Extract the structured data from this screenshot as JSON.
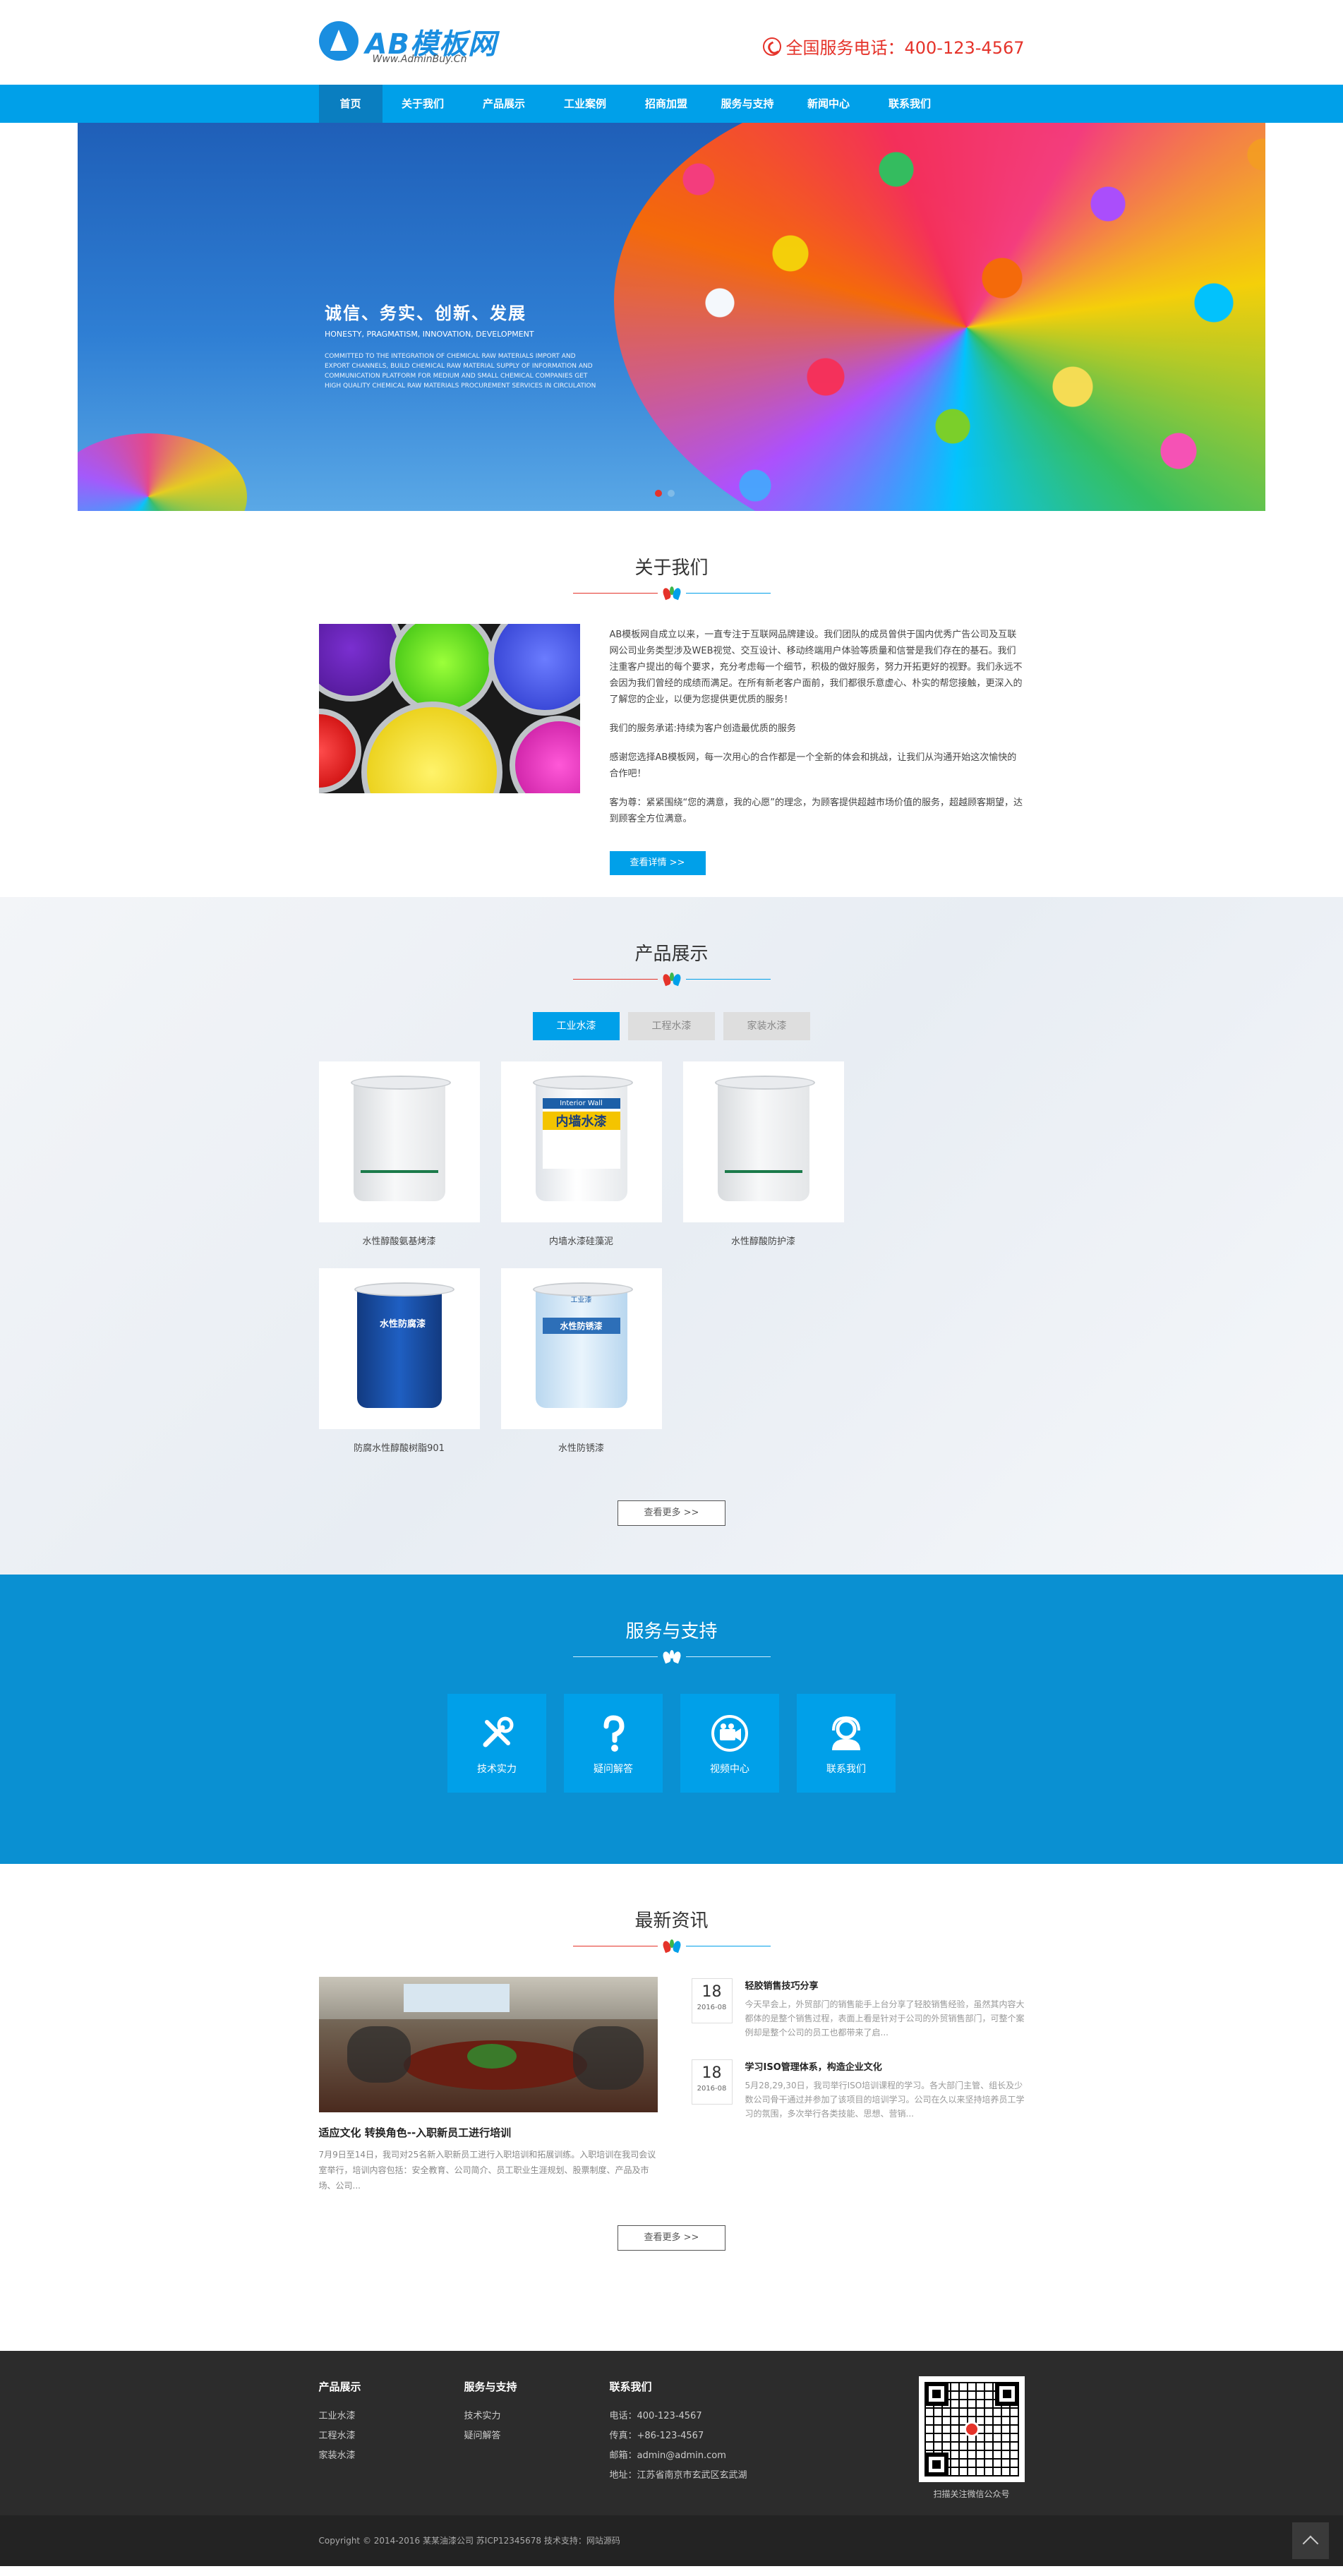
{
  "header": {
    "logo_title": "AB模板网",
    "logo_sub": "Www.AdminBuy.Cn",
    "hotline": "全国服务电话：400-123-4567"
  },
  "nav": [
    "首页",
    "关于我们",
    "产品展示",
    "工业案例",
    "招商加盟",
    "服务与支持",
    "新闻中心",
    "联系我们"
  ],
  "banner": {
    "heading": "诚信、务实、创新、发展",
    "english": "HONESTY, PRAGMATISM, INNOVATION, DEVELOPMENT",
    "paragraph": "COMMITTED TO THE INTEGRATION OF CHEMICAL RAW MATERIALS IMPORT AND EXPORT CHANNELS, BUILD CHEMICAL RAW MATERIAL SUPPLY OF INFORMATION AND COMMUNICATION PLATFORM FOR MEDIUM AND SMALL CHEMICAL COMPANIES GET HIGH QUALITY CHEMICAL RAW MATERIALS PROCUREMENT SERVICES IN CIRCULATION"
  },
  "about": {
    "title": "关于我们",
    "paragraphs": [
      "AB模板网自成立以来，一直专注于互联网品牌建设。我们团队的成员曾供于国内优秀广告公司及互联网公司业务类型涉及WEB视觉、交互设计、移动终端用户体验等质量和信誉是我们存在的基石。我们注重客户提出的每个要求，充分考虑每一个细节，积极的做好服务，努力开拓更好的视野。我们永远不会因为我们曾经的成绩而满足。在所有新老客户面前，我们都很乐意虚心、朴实的帮您接触，更深入的了解您的企业，以便为您提供更优质的服务！",
      "我们的服务承诺:持续为客户创造最优质的服务",
      "感谢您选择AB模板网，每一次用心的合作都是一个全新的体会和挑战，让我们从沟通开始这次愉快的合作吧！",
      "客为尊：紧紧围绕“您的满意，我的心愿”的理念，为顾客提供超越市场价值的服务，超越顾客期望，达到顾客全方位满意。"
    ],
    "button": "查看详情 >>"
  },
  "products": {
    "title": "产品展示",
    "tabs": [
      "工业水漆",
      "工程水漆",
      "家装水漆"
    ],
    "items": [
      "水性醇酸氨基烤漆",
      "内墙水漆硅藻泥",
      "水性醇酸防护漆",
      "防腐水性醇酸树脂901",
      "水性防锈漆"
    ],
    "bucket_texts": [
      "Interior Wall",
      "内墙水漆",
      "水性防腐漆",
      "工业漆",
      "水性防锈漆"
    ],
    "more": "查看更多 >>"
  },
  "service": {
    "title": "服务与支持",
    "items": [
      {
        "label": "技术实力",
        "icon": "tools-icon"
      },
      {
        "label": "疑问解答",
        "icon": "question-icon"
      },
      {
        "label": "视频中心",
        "icon": "video-icon"
      },
      {
        "label": "联系我们",
        "icon": "support-icon"
      }
    ]
  },
  "news": {
    "title": "最新资讯",
    "featured": {
      "title": "适应文化 转换角色--入职新员工进行培训",
      "desc": "7月9日至14日，我司对25名新入职新员工进行入职培训和拓展训练。入职培训在我司会议室举行，培训内容包括：安全教育、公司简介、员工职业生涯规划、股票制度、产品及市场、公司..."
    },
    "items": [
      {
        "day": "18",
        "month": "2016-08",
        "title": "轻胶销售技巧分享",
        "desc": "今天早会上，外贸部门的销售能手上台分享了轻胶销售经验，虽然其内容大都体的是整个销售过程，表面上看是针对于公司的外贸销售部门，可整个案例却是整个公司的员工也都带来了启..."
      },
      {
        "day": "18",
        "month": "2016-08",
        "title": "学习ISO管理体系，构造企业文化",
        "desc": "5月28,29,30日，我司举行ISO培训课程的学习。各大部门主管、组长及少数公司骨干通过并参加了该项目的培训学习。公司在久以来坚持培养员工学习的氛围，多次举行各类技能、思想、营销..."
      }
    ],
    "more": "查看更多 >>"
  },
  "footer": {
    "col1": {
      "title": "产品展示",
      "links": [
        "工业水漆",
        "工程水漆",
        "家装水漆"
      ]
    },
    "col2": {
      "title": "服务与支持",
      "links": [
        "技术实力",
        "疑问解答"
      ]
    },
    "col3": {
      "title": "联系我们",
      "lines": [
        "电话：400-123-4567",
        "传真：+86-123-4567",
        "邮箱：admin@admin.com",
        "地址：江苏省南京市玄武区玄武湖"
      ]
    },
    "qr_caption": "扫描关注微信公众号",
    "copyright": "Copyright © 2014-2016 某某油漆公司   苏ICP12345678   技术支持：网站源码"
  },
  "colors": {
    "primary": "#00a0e9",
    "service_bg": "#0a90d2",
    "accent_red": "#e5332a",
    "footer_bg": "#2c2c2c"
  }
}
